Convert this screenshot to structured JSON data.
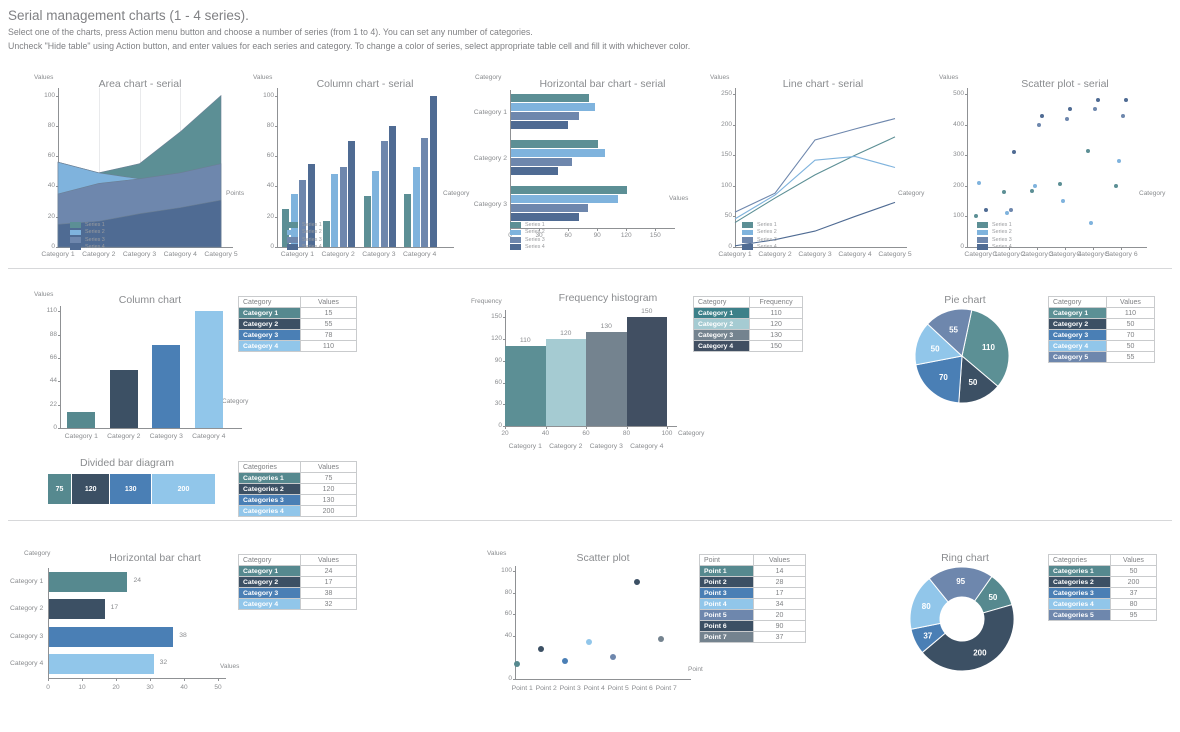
{
  "header": {
    "title": "Serial management charts (1 - 4 series).",
    "line1": "Select one of the charts, press Action menu button and choose a number of series (from 1 to 4). You can set any number of categories.",
    "line2": "Uncheck \"Hide table\" using Action button, and enter values for each series and category. To change a color of series, select appropriate table cell and fill it with whichever color."
  },
  "palette": {
    "series1": "#5c8f95",
    "series2": "#7fb3dd",
    "series3": "#6e87ad",
    "series4": "#4f6b93",
    "dark_slate": "#3c5064",
    "light_teal": "#a5cbd2",
    "grey_blue": "#74838f",
    "mid_blue": "#4a7fb5",
    "pale_blue": "#91c6ea",
    "teal": "#56898f",
    "axis": "#8f9194",
    "text": "#808184",
    "grid": "#e9eaec"
  },
  "series_legend": [
    "Series 1",
    "Series 2",
    "Series 3",
    "Series 4"
  ],
  "chart_data": [
    {
      "id": "area-chart-serial",
      "type": "area",
      "title": "Area chart - serial",
      "ylabel": "Values",
      "xlabel": "Points",
      "categories": [
        "Category 1",
        "Category 2",
        "Category 3",
        "Category 4",
        "Category 5"
      ],
      "yticks": [
        0,
        20,
        40,
        60,
        80,
        100
      ],
      "ylim": [
        0,
        105
      ],
      "legend": [
        "Series 1",
        "Series 2",
        "Series 3",
        "Series 4"
      ],
      "series": [
        {
          "name": "Series 1",
          "color": "#5c8f95",
          "values": [
            56,
            49,
            55,
            76,
            100
          ]
        },
        {
          "name": "Series 2",
          "color": "#7fb3dd",
          "values": [
            56,
            49,
            45,
            39,
            30
          ]
        },
        {
          "name": "Series 3",
          "color": "#6e87ad",
          "values": [
            35,
            42,
            45,
            49,
            55
          ]
        },
        {
          "name": "Series 4",
          "color": "#4f6b93",
          "values": [
            15,
            17,
            22,
            26,
            31
          ]
        }
      ]
    },
    {
      "id": "column-chart-serial",
      "type": "bar",
      "title": "Column chart - serial",
      "ylabel": "Values",
      "xlabel": "Category",
      "categories": [
        "Category 1",
        "Category 2",
        "Category 3",
        "Category 4"
      ],
      "yticks": [
        0,
        20,
        40,
        60,
        80,
        100
      ],
      "ylim": [
        0,
        105
      ],
      "legend": [
        "Series 1",
        "Series 2",
        "Series 3",
        "Series 4"
      ],
      "series": [
        {
          "name": "Series 1",
          "color": "#5c8f95",
          "values": [
            25,
            17,
            34,
            35
          ]
        },
        {
          "name": "Series 2",
          "color": "#7fb3dd",
          "values": [
            35,
            48,
            50,
            53
          ]
        },
        {
          "name": "Series 3",
          "color": "#6e87ad",
          "values": [
            44,
            53,
            70,
            72
          ]
        },
        {
          "name": "Series 4",
          "color": "#4f6b93",
          "values": [
            55,
            70,
            80,
            100
          ]
        }
      ]
    },
    {
      "id": "horizontal-bar-chart-serial",
      "type": "bar",
      "orientation": "horizontal",
      "title": "Horizontal bar chart - serial",
      "ylabel": "Category",
      "xlabel": "Values",
      "categories": [
        "Category 1",
        "Category 2",
        "Category 3"
      ],
      "xticks": [
        0,
        30,
        60,
        90,
        120,
        150
      ],
      "xlim": [
        0,
        160
      ],
      "legend": [
        "Series 1",
        "Series 2",
        "Series 3",
        "Series 4"
      ],
      "series": [
        {
          "name": "Series 1",
          "color": "#5c8f95",
          "values": [
            80,
            90,
            120
          ]
        },
        {
          "name": "Series 2",
          "color": "#7fb3dd",
          "values": [
            87,
            97,
            110
          ]
        },
        {
          "name": "Series 3",
          "color": "#6e87ad",
          "values": [
            70,
            63,
            79
          ]
        },
        {
          "name": "Series 4",
          "color": "#4f6b93",
          "values": [
            59,
            49,
            70
          ]
        }
      ]
    },
    {
      "id": "line-chart-serial",
      "type": "line",
      "title": "Line chart - serial",
      "ylabel": "Values",
      "xlabel": "Category",
      "categories": [
        "Category 1",
        "Category 2",
        "Category 3",
        "Category 4",
        "Category 5"
      ],
      "yticks": [
        0,
        50,
        100,
        150,
        200,
        250
      ],
      "ylim": [
        0,
        260
      ],
      "legend": [
        "Series 1",
        "Series 2",
        "Series 3",
        "Series 4"
      ],
      "series": [
        {
          "name": "Series 1",
          "color": "#5c8f95",
          "values": [
            40,
            80,
            118,
            150,
            180
          ]
        },
        {
          "name": "Series 2",
          "color": "#7fb3dd",
          "values": [
            46,
            85,
            142,
            148,
            130
          ]
        },
        {
          "name": "Series 3",
          "color": "#6e87ad",
          "values": [
            57,
            88,
            175,
            193,
            210
          ]
        },
        {
          "name": "Series 4",
          "color": "#4f6b93",
          "values": [
            2,
            12,
            26,
            50,
            73
          ]
        }
      ]
    },
    {
      "id": "scatter-plot-serial",
      "type": "scatter",
      "title": "Scatter plot - serial",
      "ylabel": "Values",
      "xlabel": "Category",
      "categories": [
        "Category 1",
        "Category 2",
        "Category 3",
        "Category 4",
        "Category 5",
        "Category 6"
      ],
      "yticks": [
        0,
        100,
        200,
        300,
        400,
        500
      ],
      "ylim": [
        0,
        520
      ],
      "legend": [
        "Series 1",
        "Series 2",
        "Series 3",
        "Series 4"
      ],
      "series": [
        {
          "name": "Series 1",
          "color": "#5c8f95",
          "values": [
            100,
            180,
            182,
            205,
            315,
            200
          ]
        },
        {
          "name": "Series 2",
          "color": "#7fb3dd",
          "values": [
            210,
            112,
            200,
            152,
            80,
            280
          ]
        },
        {
          "name": "Series 3",
          "color": "#6e87ad",
          "values": [
            50,
            122,
            400,
            420,
            450,
            430
          ]
        },
        {
          "name": "Series 4",
          "color": "#4f6b93",
          "values": [
            120,
            311,
            430,
            450,
            480,
            480
          ]
        }
      ]
    },
    {
      "id": "column-chart",
      "type": "bar",
      "title": "Column chart",
      "ylabel": "Values",
      "xlabel": "Category",
      "yticks": [
        0,
        22,
        44,
        66,
        88,
        110
      ],
      "ylim": [
        0,
        115
      ],
      "categories": [
        "Category 1",
        "Category 2",
        "Category 3",
        "Category 4"
      ],
      "values": [
        15,
        55,
        78,
        110
      ],
      "colors": [
        "#56898f",
        "#3c5064",
        "#4a7fb5",
        "#91c6ea"
      ],
      "table": {
        "headers": [
          "Category",
          "Values"
        ],
        "rows": [
          {
            "name": "Category 1",
            "value": "15",
            "color": "#56898f"
          },
          {
            "name": "Category 2",
            "value": "55",
            "color": "#3c5064"
          },
          {
            "name": "Category 3",
            "value": "78",
            "color": "#4a7fb5"
          },
          {
            "name": "Category 4",
            "value": "110",
            "color": "#91c6ea"
          }
        ]
      }
    },
    {
      "id": "frequency-histogram",
      "type": "bar",
      "title": "Frequency histogram",
      "ylabel": "Frequency",
      "xlabel": "Category",
      "yticks": [
        0,
        30,
        60,
        90,
        120,
        150
      ],
      "ylim": [
        0,
        160
      ],
      "xticks": [
        20,
        40,
        60,
        80,
        100
      ],
      "categories": [
        "Category 1",
        "Category 2",
        "Category 3",
        "Category 4"
      ],
      "values": [
        110,
        120,
        130,
        150
      ],
      "colors": [
        "#5c8f95",
        "#a5cbd2",
        "#74838f",
        "#414f62"
      ],
      "table": {
        "headers": [
          "Category",
          "Frequency"
        ],
        "rows": [
          {
            "name": "Category 1",
            "value": "110",
            "color": "#3c8089"
          },
          {
            "name": "Category 2",
            "value": "120",
            "color": "#a5cbd2"
          },
          {
            "name": "Category 3",
            "value": "130",
            "color": "#74838f"
          },
          {
            "name": "Category 4",
            "value": "150",
            "color": "#414f62"
          }
        ]
      }
    },
    {
      "id": "pie-chart",
      "type": "pie",
      "title": "Pie chart",
      "labels": [
        "Category 1",
        "Category 2",
        "Category 3",
        "Category 4",
        "Category 5"
      ],
      "values": [
        110,
        50,
        70,
        50,
        55
      ],
      "colors": [
        "#5c9095",
        "#3c5064",
        "#4a7fb5",
        "#91c6ea",
        "#6e87ad"
      ],
      "table": {
        "headers": [
          "Category",
          "Values"
        ],
        "rows": [
          {
            "name": "Category 1",
            "value": "110",
            "color": "#5c9095"
          },
          {
            "name": "Category 2",
            "value": "50",
            "color": "#3c5064"
          },
          {
            "name": "Category 3",
            "value": "70",
            "color": "#4a7fb5"
          },
          {
            "name": "Category 4",
            "value": "50",
            "color": "#91c6ea"
          },
          {
            "name": "Category 5",
            "value": "55",
            "color": "#6e87ad"
          }
        ]
      }
    },
    {
      "id": "divided-bar-diagram",
      "type": "bar",
      "title": "Divided bar diagram",
      "labels": [
        "Categories 1",
        "Categories 2",
        "Categories 3",
        "Categories 4"
      ],
      "values": [
        75,
        120,
        130,
        200
      ],
      "colors": [
        "#56898f",
        "#3c5064",
        "#4a7fb5",
        "#91c6ea"
      ],
      "table": {
        "headers": [
          "Categories",
          "Values"
        ],
        "rows": [
          {
            "name": "Categories 1",
            "value": "75",
            "color": "#56898f"
          },
          {
            "name": "Categories 2",
            "value": "120",
            "color": "#3c5064"
          },
          {
            "name": "Categories 3",
            "value": "130",
            "color": "#4a7fb5"
          },
          {
            "name": "Categories 4",
            "value": "200",
            "color": "#91c6ea"
          }
        ]
      }
    },
    {
      "id": "horizontal-bar-chart",
      "type": "bar",
      "orientation": "horizontal",
      "title": "Horizontal bar chart",
      "ylabel": "Category",
      "xlabel": "Values",
      "xticks": [
        0,
        10,
        20,
        30,
        40,
        50
      ],
      "xlim": [
        0,
        52
      ],
      "categories": [
        "Category 1",
        "Category 2",
        "Category 3",
        "Category 4"
      ],
      "values": [
        24,
        17,
        38,
        32
      ],
      "colors": [
        "#56898f",
        "#3c5064",
        "#4a7fb5",
        "#91c6ea"
      ],
      "table": {
        "headers": [
          "Category",
          "Values"
        ],
        "rows": [
          {
            "name": "Category 1",
            "value": "24",
            "color": "#56898f"
          },
          {
            "name": "Category 2",
            "value": "17",
            "color": "#3c5064"
          },
          {
            "name": "Category 3",
            "value": "38",
            "color": "#4a7fb5"
          },
          {
            "name": "Category 4",
            "value": "32",
            "color": "#91c6ea"
          }
        ]
      }
    },
    {
      "id": "scatter-plot",
      "type": "scatter",
      "title": "Scatter plot",
      "ylabel": "Values",
      "xlabel": "Point",
      "yticks": [
        0,
        40,
        60,
        80,
        100
      ],
      "ylim": [
        0,
        105
      ],
      "categories": [
        "Point 1",
        "Point 2",
        "Point 3",
        "Point 4",
        "Point 5",
        "Point 6",
        "Point 7"
      ],
      "values": [
        14,
        28,
        17,
        34,
        20,
        90,
        37
      ],
      "colors": [
        "#56898f",
        "#3c5064",
        "#4a7fb5",
        "#91c6ea",
        "#6e87ad",
        "#3c5064",
        "#74838f"
      ],
      "table": {
        "headers": [
          "Point",
          "Values"
        ],
        "rows": [
          {
            "name": "Point 1",
            "value": "14",
            "color": "#56898f"
          },
          {
            "name": "Point 2",
            "value": "28",
            "color": "#3c5064"
          },
          {
            "name": "Point 3",
            "value": "17",
            "color": "#4a7fb5"
          },
          {
            "name": "Point 4",
            "value": "34",
            "color": "#91c6ea"
          },
          {
            "name": "Point 5",
            "value": "20",
            "color": "#6e87ad"
          },
          {
            "name": "Point 6",
            "value": "90",
            "color": "#3c5064"
          },
          {
            "name": "Point 7",
            "value": "37",
            "color": "#74838f"
          }
        ]
      }
    },
    {
      "id": "ring-chart",
      "type": "pie",
      "variant": "donut",
      "title": "Ring chart",
      "labels": [
        "Categories 1",
        "Categories 2",
        "Categories 3",
        "Categories 4",
        "Categories 5"
      ],
      "values": [
        50,
        200,
        37,
        80,
        95
      ],
      "colors": [
        "#56898f",
        "#3c5064",
        "#4a7fb5",
        "#91c6ea",
        "#6e87ad"
      ],
      "table": {
        "headers": [
          "Categories",
          "Values"
        ],
        "rows": [
          {
            "name": "Categories 1",
            "value": "50",
            "color": "#56898f"
          },
          {
            "name": "Categories 2",
            "value": "200",
            "color": "#3c5064"
          },
          {
            "name": "Categories 3",
            "value": "37",
            "color": "#4a7fb5"
          },
          {
            "name": "Categories 4",
            "value": "80",
            "color": "#91c6ea"
          },
          {
            "name": "Categories 5",
            "value": "95",
            "color": "#6e87ad"
          }
        ]
      }
    }
  ]
}
